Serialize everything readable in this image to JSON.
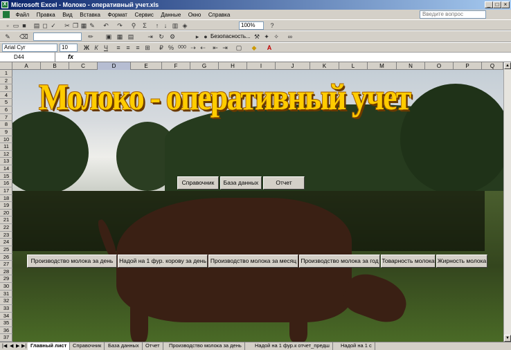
{
  "window": {
    "title": "Microsoft Excel - Молоко - оперативный учет.xls",
    "app_icon": "X"
  },
  "menu": [
    "Файл",
    "Правка",
    "Вид",
    "Вставка",
    "Формат",
    "Сервис",
    "Данные",
    "Окно",
    "Справка"
  ],
  "help_placeholder": "Введите вопрос",
  "toolbar": {
    "zoom": "100%",
    "security_label": "Безопасность..."
  },
  "format": {
    "font": "Arial Cyr",
    "size": "10",
    "bold": "Ж",
    "italic": "К",
    "underline": "Ч",
    "percent": "%",
    "thousands": "000"
  },
  "namebox": "D44",
  "fx": "fx",
  "columns": [
    "A",
    "B",
    "C",
    "D",
    "E",
    "F",
    "G",
    "H",
    "I",
    "J",
    "K",
    "L",
    "M",
    "N",
    "O",
    "P",
    "Q"
  ],
  "rows": [
    "1",
    "2",
    "3",
    "4",
    "5",
    "6",
    "7",
    "8",
    "9",
    "10",
    "11",
    "12",
    "13",
    "14",
    "15",
    "16",
    "17",
    "18",
    "19",
    "20",
    "21",
    "22",
    "23",
    "24",
    "25",
    "26",
    "27",
    "28",
    "29",
    "30",
    "31",
    "32",
    "33",
    "34",
    "35",
    "36",
    "37"
  ],
  "sheet": {
    "title": "Молоко - оперативный учет",
    "nav_buttons": [
      "Справочник",
      "База данных",
      "Отчет"
    ],
    "report_buttons": [
      "Производство молока за день",
      "Надой на 1 фур. корову за день",
      "Производство молока за месяц",
      "Производство молока за год",
      "Товарность молока",
      "Жирность молока"
    ]
  },
  "tabs": [
    "Главный лист",
    "Справочник",
    "База данных",
    "Отчет",
    "Производство молока за день",
    "Надой на 1 фур.к отчет_предш",
    "Надой на 1 с"
  ],
  "tab_nav": [
    "|◀",
    "◀",
    "▶",
    "▶|"
  ]
}
